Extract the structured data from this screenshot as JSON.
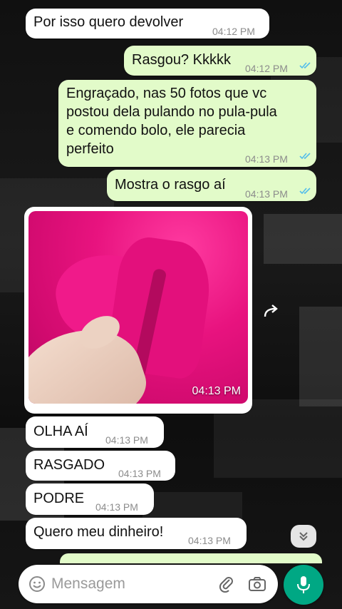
{
  "colors": {
    "incoming_bubble": "#ffffff",
    "outgoing_bubble": "#e2fbc9",
    "timestamp": "#8c8c8c",
    "read_ticks": "#53bdeb",
    "accent": "#00a884"
  },
  "messages": [
    {
      "direction": "in",
      "text": "Por isso quero devolver",
      "time": "04:12 PM"
    },
    {
      "direction": "out",
      "text": "Rasgou? Kkkkk",
      "time": "04:12 PM",
      "status": "read"
    },
    {
      "direction": "out",
      "lines": [
        "Engraçado, nas 50 fotos que vc",
        "postou dela pulando no pula-pula",
        "e comendo bolo, ele parecia",
        "perfeito"
      ],
      "time": "04:13 PM",
      "status": "read"
    },
    {
      "direction": "out",
      "text": "Mostra o rasgo aí",
      "time": "04:13 PM",
      "status": "read"
    },
    {
      "direction": "in",
      "type": "image",
      "content": "photo of torn pink fabric held in hand",
      "time": "04:13 PM"
    },
    {
      "direction": "in",
      "text": "OLHA AÍ",
      "time": "04:13 PM"
    },
    {
      "direction": "in",
      "text": "RASGADO",
      "time": "04:13 PM"
    },
    {
      "direction": "in",
      "text": "PODRE",
      "time": "04:13 PM"
    },
    {
      "direction": "in",
      "text": "Quero meu dinheiro!",
      "time": "04:13 PM"
    }
  ],
  "icons": {
    "forward": "forward-arrow-icon",
    "scroll_down": "double-chevron-down-icon",
    "emoji": "smiley-icon",
    "attach": "paperclip-icon",
    "camera": "camera-icon",
    "mic": "microphone-icon"
  },
  "composer": {
    "placeholder": "Mensagem"
  }
}
